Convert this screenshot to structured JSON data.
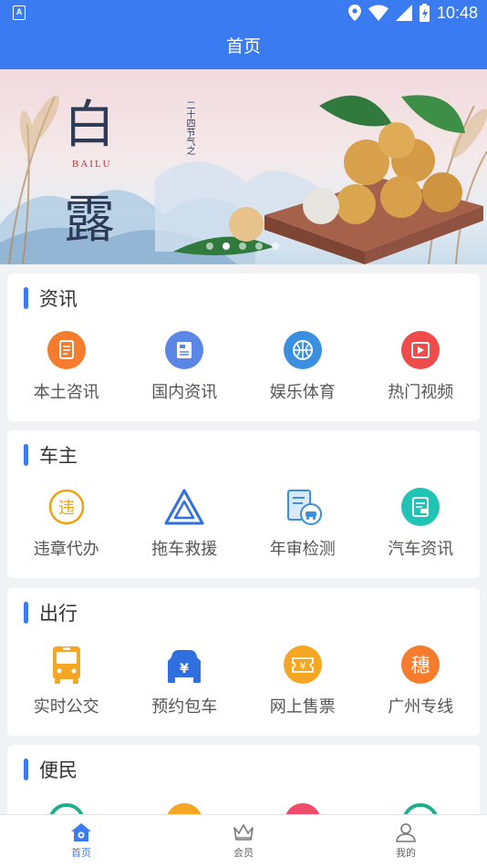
{
  "status_bar": {
    "time": "10:48",
    "notification_icon": "A"
  },
  "header": {
    "title": "首页"
  },
  "banner": {
    "title_char_1": "白",
    "title_char_2": "露",
    "subtitle": "BAILU",
    "tag": "二十四节气之",
    "slide_count": 5,
    "active_index": 1
  },
  "sections": [
    {
      "title": "资讯",
      "items": [
        {
          "label": "本土咨讯",
          "icon": "document-icon",
          "color": "#f47c2c"
        },
        {
          "label": "国内资讯",
          "icon": "news-icon",
          "color": "#5b86e5"
        },
        {
          "label": "娱乐体育",
          "icon": "basketball-icon",
          "color": "#3a8fe0"
        },
        {
          "label": "热门视频",
          "icon": "video-play-icon",
          "color": "#ef4b4b"
        }
      ]
    },
    {
      "title": "车主",
      "items": [
        {
          "label": "违章代办",
          "icon": "violation-icon",
          "color": "#f0a30a",
          "glyph": "违"
        },
        {
          "label": "拖车救援",
          "icon": "warning-triangle-icon",
          "color": "#2f6fe0"
        },
        {
          "label": "年审检测",
          "icon": "car-inspection-icon",
          "color": "#3a8fe0"
        },
        {
          "label": "汽车资讯",
          "icon": "car-news-icon",
          "color": "#1fc4b5"
        }
      ]
    },
    {
      "title": "出行",
      "items": [
        {
          "label": "实时公交",
          "icon": "bus-icon",
          "color": "#f5a623"
        },
        {
          "label": "预约包车",
          "icon": "charter-car-icon",
          "color": "#2f6fe0",
          "glyph": "¥"
        },
        {
          "label": "网上售票",
          "icon": "ticket-icon",
          "color": "#f5a623",
          "glyph": "¥"
        },
        {
          "label": "广州专线",
          "icon": "guangzhou-line-icon",
          "color": "#f47c2c",
          "glyph": "穗"
        }
      ]
    },
    {
      "title": "便民",
      "items": []
    }
  ],
  "tabbar": [
    {
      "label": "首页",
      "icon": "home-icon",
      "active": true
    },
    {
      "label": "会员",
      "icon": "crown-icon",
      "active": false
    },
    {
      "label": "我的",
      "icon": "user-icon",
      "active": false
    }
  ],
  "colors": {
    "primary": "#3a7bf2",
    "background": "#f1f2f4"
  }
}
